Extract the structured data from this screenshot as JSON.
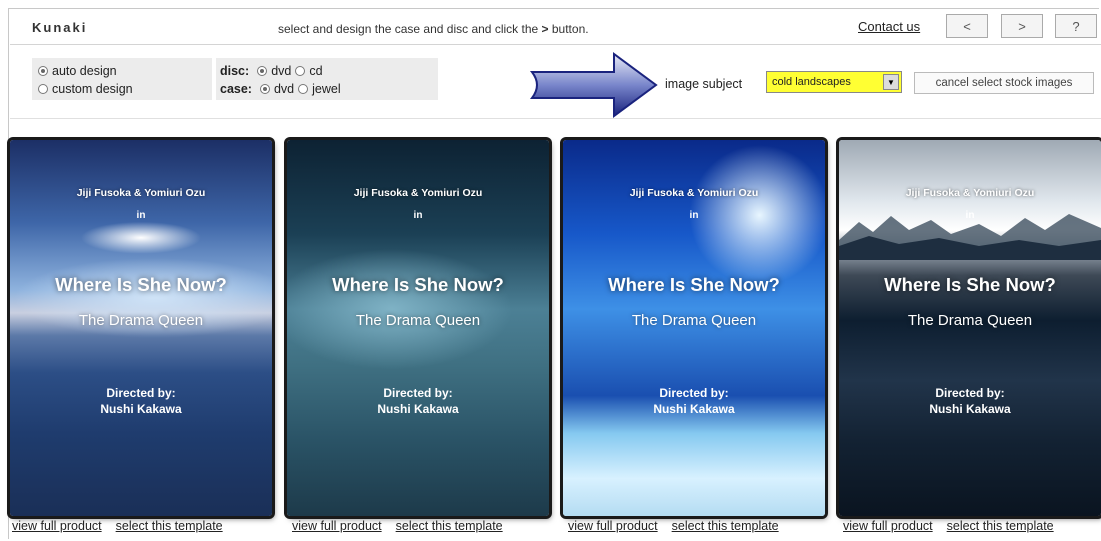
{
  "header": {
    "brand": "Kunaki",
    "instruction_prefix": "select and design the case and disc and click the",
    "instruction_key": ">",
    "instruction_suffix": "button.",
    "contact_label": "Contact us",
    "nav": {
      "prev": "<",
      "next": ">",
      "help": "?"
    }
  },
  "options": {
    "design": [
      {
        "label": "auto design",
        "selected": true
      },
      {
        "label": "custom design",
        "selected": false
      }
    ],
    "disc": {
      "label": "disc:",
      "options": [
        "dvd",
        "cd"
      ],
      "selected": "dvd"
    },
    "case": {
      "label": "case:",
      "options": [
        "dvd",
        "jewel"
      ],
      "selected": "dvd"
    }
  },
  "subject": {
    "label": "image subject",
    "value": "cold landscapes",
    "cancel_label": "cancel select stock images"
  },
  "covers": [
    {
      "authors": "Jiji Fusoka & Yomiuri Ozu",
      "in": "in",
      "title": "Where Is She Now?",
      "subtitle": "The Drama Queen",
      "directed_label": "Directed by:",
      "director": "Nushi Kakawa"
    },
    {
      "authors": "Jiji Fusoka & Yomiuri Ozu",
      "in": "in",
      "title": "Where Is She Now?",
      "subtitle": "The Drama Queen",
      "directed_label": "Directed by:",
      "director": "Nushi Kakawa"
    },
    {
      "authors": "Jiji Fusoka & Yomiuri Ozu",
      "in": "in",
      "title": "Where Is She Now?",
      "subtitle": "The Drama Queen",
      "directed_label": "Directed by:",
      "director": "Nushi Kakawa"
    },
    {
      "authors": "Jiji Fusoka & Yomiuri Ozu",
      "in": "in",
      "title": "Where Is She Now?",
      "subtitle": "The Drama Queen",
      "directed_label": "Directed by:",
      "director": "Nushi Kakawa"
    }
  ],
  "template_links": {
    "view": "view full product",
    "select": "select this template"
  },
  "colors": {
    "select_highlight": "#ffff33",
    "arrow_fill": "#1a237e"
  }
}
